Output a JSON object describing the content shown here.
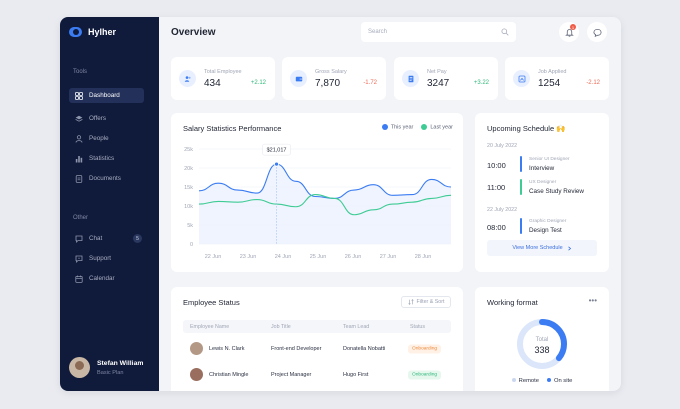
{
  "brand": {
    "name": "Hylher",
    "color": "#3b7cf2"
  },
  "sidebar": {
    "tools_heading": "Tools",
    "other_heading": "Other",
    "items": [
      {
        "label": "Dashboard",
        "icon": "dashboard-icon",
        "active": true
      },
      {
        "label": "Offers",
        "icon": "layers-icon"
      },
      {
        "label": "People",
        "icon": "person-icon"
      },
      {
        "label": "Statistics",
        "icon": "bar-chart-icon"
      },
      {
        "label": "Documents",
        "icon": "document-icon"
      }
    ],
    "other_items": [
      {
        "label": "Chat",
        "icon": "chat-icon",
        "badge": "5"
      },
      {
        "label": "Support",
        "icon": "support-icon"
      },
      {
        "label": "Calendar",
        "icon": "calendar-icon"
      }
    ],
    "user": {
      "name": "Stefan William",
      "plan": "Basic Plan"
    }
  },
  "header": {
    "title": "Overview",
    "search_placeholder": "Search",
    "notification_count": "1"
  },
  "stats": [
    {
      "label": "Total Employee",
      "value": "434",
      "delta": "+2.12",
      "trend": "up",
      "icon": "people-icon"
    },
    {
      "label": "Gross Salary",
      "value": "7,870",
      "delta": "-1.72",
      "trend": "down",
      "icon": "wallet-icon"
    },
    {
      "label": "Net Pay",
      "value": "3247",
      "delta": "+3.22",
      "trend": "up",
      "icon": "receipt-icon"
    },
    {
      "label": "Job Applied",
      "value": "1254",
      "delta": "-2.12",
      "trend": "down",
      "icon": "briefcase-icon"
    }
  ],
  "chart": {
    "title": "Salary Statistics Performance",
    "legend_this_year": "This year",
    "legend_last_year": "Last year",
    "tooltip": "$21,017",
    "colors": {
      "this_year": "#3b7cf2",
      "last_year": "#3ecb94"
    }
  },
  "chart_data": {
    "type": "line",
    "x": [
      "22 Jun",
      "23 Jun",
      "24 Jun",
      "25 Jun",
      "26 Jun",
      "27 Jun",
      "28 Jun"
    ],
    "y_ticks": [
      "0",
      "5k",
      "10k",
      "15k",
      "20k",
      "25k"
    ],
    "ylim": [
      0,
      25000
    ],
    "series": [
      {
        "name": "This year",
        "values": [
          14000,
          16000,
          14200,
          13400,
          21017,
          16500,
          12500,
          12000,
          14200,
          15600,
          12800,
          13000,
          17000,
          15000
        ],
        "color": "#3b7cf2"
      },
      {
        "name": "Last year",
        "values": [
          10500,
          11200,
          11000,
          11700,
          10500,
          9800,
          13000,
          12000,
          7700,
          9000,
          10500,
          11000,
          12000,
          12800
        ],
        "color": "#3ecb94"
      }
    ],
    "grid": true,
    "legend": "top-right"
  },
  "schedule": {
    "title": "Upcoming Schedule",
    "title_emoji": "🙌",
    "groups": [
      {
        "date": "20 July 2022",
        "items": [
          {
            "time": "10:00",
            "sub": "Senior UI Designer",
            "title": "Interview",
            "color": "#3b7cf2"
          },
          {
            "time": "11:00",
            "sub": "UX Designer",
            "title": "Case Study Review",
            "color": "#3ecb94"
          }
        ]
      },
      {
        "date": "22 July 2022",
        "items": [
          {
            "time": "08:00",
            "sub": "Graphic Designer",
            "title": "Design Test",
            "color": "#3b7cf2"
          }
        ]
      }
    ],
    "view_more": "View More Schedule"
  },
  "employees": {
    "title": "Employee Status",
    "filter_label": "Filter & Sort",
    "columns": [
      "Employee Name",
      "Job Title",
      "Team Lead",
      "Status"
    ],
    "rows": [
      {
        "name": "Lewis N. Clark",
        "job": "Front-end Developer",
        "lead": "Donatella Nobatti",
        "status": "Onboarding",
        "status_color": "orange"
      },
      {
        "name": "Christian Mingle",
        "job": "Project Manager",
        "lead": "Hugo First",
        "status": "Onboarding",
        "status_color": "green"
      }
    ]
  },
  "work_format": {
    "title": "Working format",
    "total_label": "Total",
    "total_value": "338",
    "remote_label": "Remote",
    "onsite_label": "On site",
    "onsite_fraction": 0.36,
    "colors": {
      "remote": "#dbe6fb",
      "onsite": "#3b7cf2"
    }
  }
}
